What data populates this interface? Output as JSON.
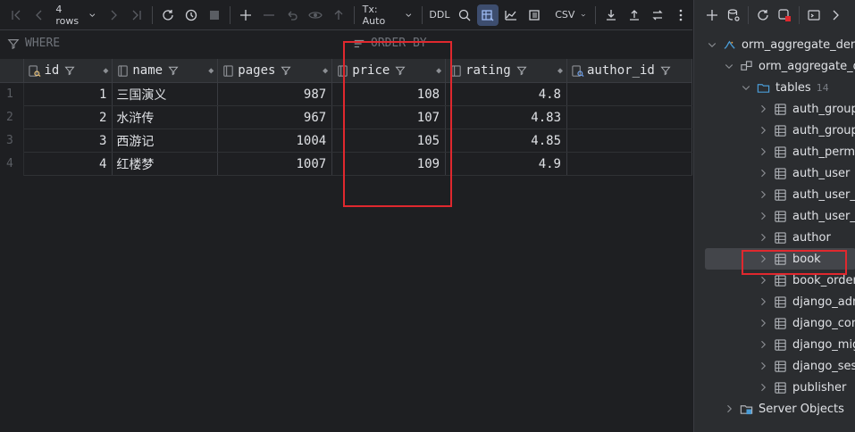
{
  "toolbar": {
    "rows_label": "4 rows",
    "tx_label": "Tx: Auto",
    "ddl_label": "DDL",
    "csv_label": "CSV"
  },
  "filter": {
    "where_label": "WHERE",
    "order_label": "ORDER BY"
  },
  "grid": {
    "columns": [
      "id",
      "name",
      "pages",
      "price",
      "rating",
      "author_id"
    ],
    "rows": [
      {
        "num": "1",
        "id": "1",
        "name": "三国演义",
        "pages": "987",
        "price": "108",
        "rating": "4.8"
      },
      {
        "num": "2",
        "id": "2",
        "name": "水浒传",
        "pages": "967",
        "price": "107",
        "rating": "4.83"
      },
      {
        "num": "3",
        "id": "3",
        "name": "西游记",
        "pages": "1004",
        "price": "105",
        "rating": "4.85"
      },
      {
        "num": "4",
        "id": "4",
        "name": "红楼梦",
        "pages": "1007",
        "price": "109",
        "rating": "4.9"
      }
    ]
  },
  "tree": {
    "db": "orm_aggregate_demo",
    "schema": "orm_aggregate_demo",
    "tables_label": "tables",
    "tables_count": "14",
    "tables": [
      "auth_group",
      "auth_group_permissions",
      "auth_permission",
      "auth_user",
      "auth_user_groups",
      "auth_user_user_permissions",
      "author",
      "book",
      "book_order",
      "django_admin_log",
      "django_content_type",
      "django_migrations",
      "django_session",
      "publisher"
    ],
    "server_objects": "Server Objects"
  },
  "colors": {
    "accent": "#3574f0",
    "highlight": "#e0282e"
  }
}
